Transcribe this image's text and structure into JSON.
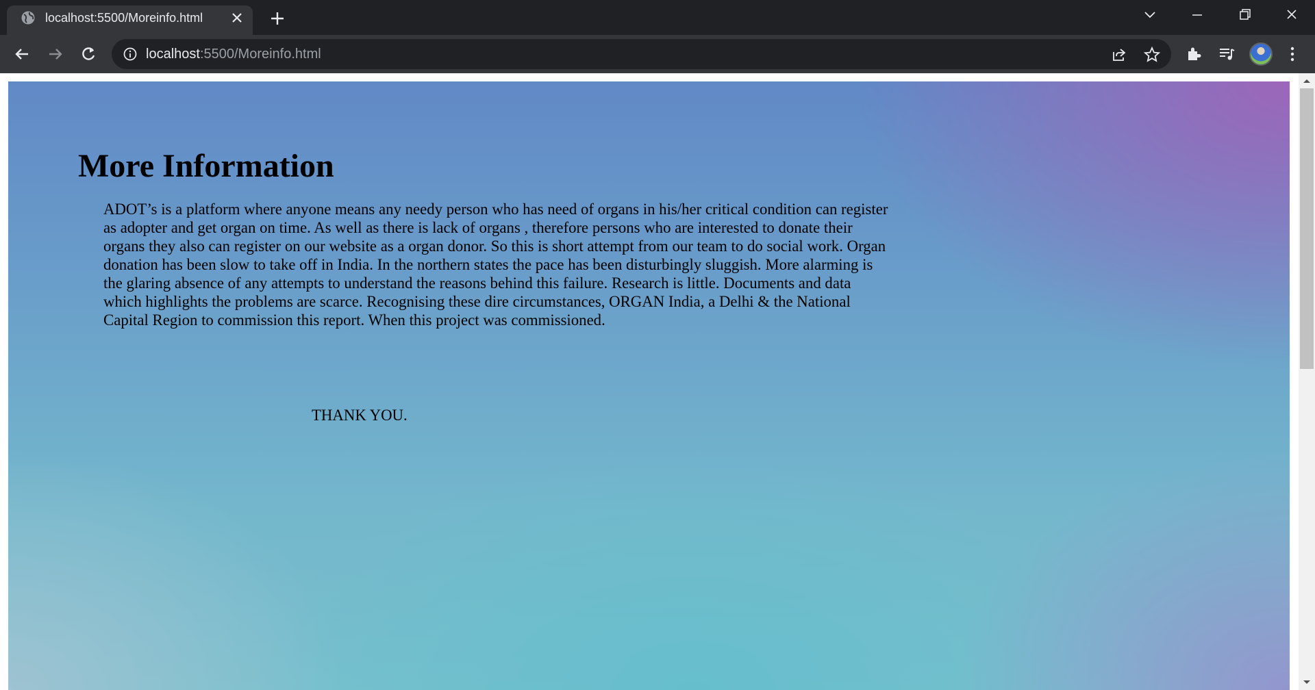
{
  "browser": {
    "tab": {
      "title": "localhost:5500/Moreinfo.html",
      "favicon": "globe-icon",
      "close_icon": "close-icon"
    },
    "new_tab_icon": "plus-icon",
    "window_controls": [
      "chevron-down-icon",
      "minimize-icon",
      "restore-icon",
      "close-icon"
    ],
    "omnibox": {
      "host": "localhost",
      "rest": ":5500/Moreinfo.html",
      "info_icon": "info-icon"
    },
    "toolbar_icons": [
      "share-icon",
      "star-icon",
      "extensions-icon",
      "media-icon",
      "avatar",
      "menu-icon"
    ]
  },
  "page": {
    "title": "More Information",
    "body": "ADOT’s is a platform where anyone means any needy person who has need of organs in his/her critical condition can register as adopter and get organ on time. As well as there is lack of organs , therefore persons who are interested to donate their organs they also can register on our website as a organ donor. So this is short attempt from our team to do social work. Organ donation has been slow to take off in India. In the northern states the pace has been disturbingly sluggish. More alarming is the glaring absence of any attempts to understand the reasons behind this failure. Research is little. Documents and data which highlights the problems are scarce. Recognising these dire circumstances, ORGAN India, a Delhi & the National Capital Region to commission this report. When this project was commissioned.",
    "thanks": "THANK YOU."
  },
  "colors": {
    "chrome_dark": "#202124",
    "chrome_mid": "#35363a",
    "gradient_top": "#6189c6",
    "gradient_purple": "#a064b9",
    "gradient_teal": "#78c0cd"
  }
}
